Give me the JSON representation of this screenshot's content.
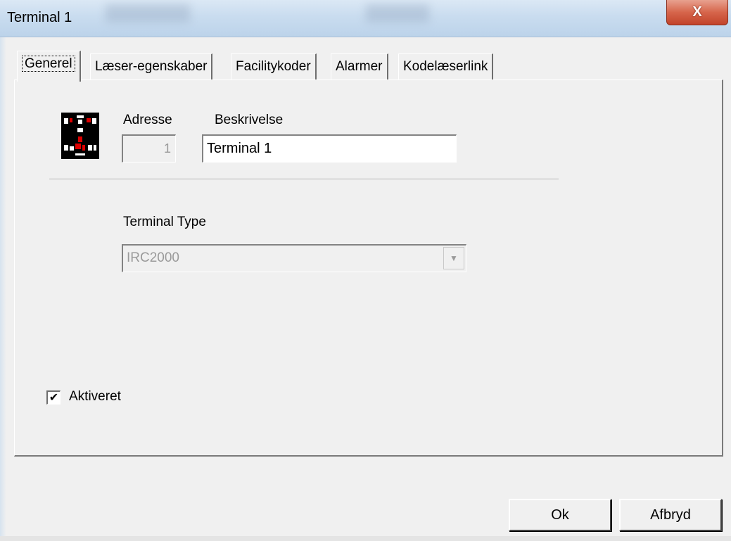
{
  "window": {
    "title": "Terminal 1",
    "close_glyph": "X"
  },
  "tabs": [
    {
      "label": "Generel",
      "active": true
    },
    {
      "label": "Læser-egenskaber",
      "active": false
    },
    {
      "label": "Facilitykoder",
      "active": false
    },
    {
      "label": "Alarmer",
      "active": false
    },
    {
      "label": "Kodelæserlink",
      "active": false
    }
  ],
  "general": {
    "icon": "terminal-device-icon",
    "address_label": "Adresse",
    "address_value": "1",
    "description_label": "Beskrivelse",
    "description_value": "Terminal 1",
    "terminal_type_label": "Terminal Type",
    "terminal_type_value": "IRC2000",
    "enabled_label": "Aktiveret",
    "enabled_checked": true,
    "check_glyph": "✔"
  },
  "buttons": {
    "ok": "Ok",
    "cancel": "Afbryd"
  },
  "colors": {
    "close_button": "#d6654b",
    "titlebar": "#c9dcef",
    "disabled_text": "#9a9a9a"
  }
}
